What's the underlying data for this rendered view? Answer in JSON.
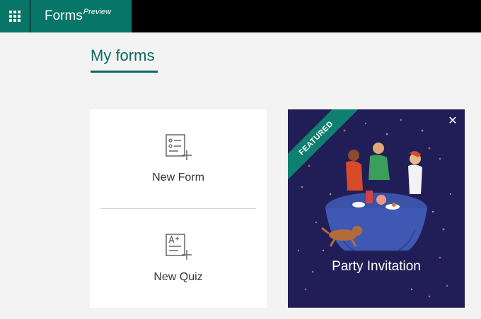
{
  "header": {
    "app_name": "Forms",
    "badge": "Preview"
  },
  "page": {
    "title": "My forms"
  },
  "create": {
    "new_form_label": "New Form",
    "new_quiz_label": "New Quiz"
  },
  "featured": {
    "ribbon": "FEATURED",
    "title": "Party Invitation"
  },
  "colors": {
    "brand": "#077568",
    "accent_text": "#0b6a5f",
    "featured_bg": "#211e57"
  },
  "icons": {
    "app_launcher": "waffle-icon",
    "new_form": "form-list-add-icon",
    "new_quiz": "quiz-add-icon",
    "close": "close-icon"
  }
}
